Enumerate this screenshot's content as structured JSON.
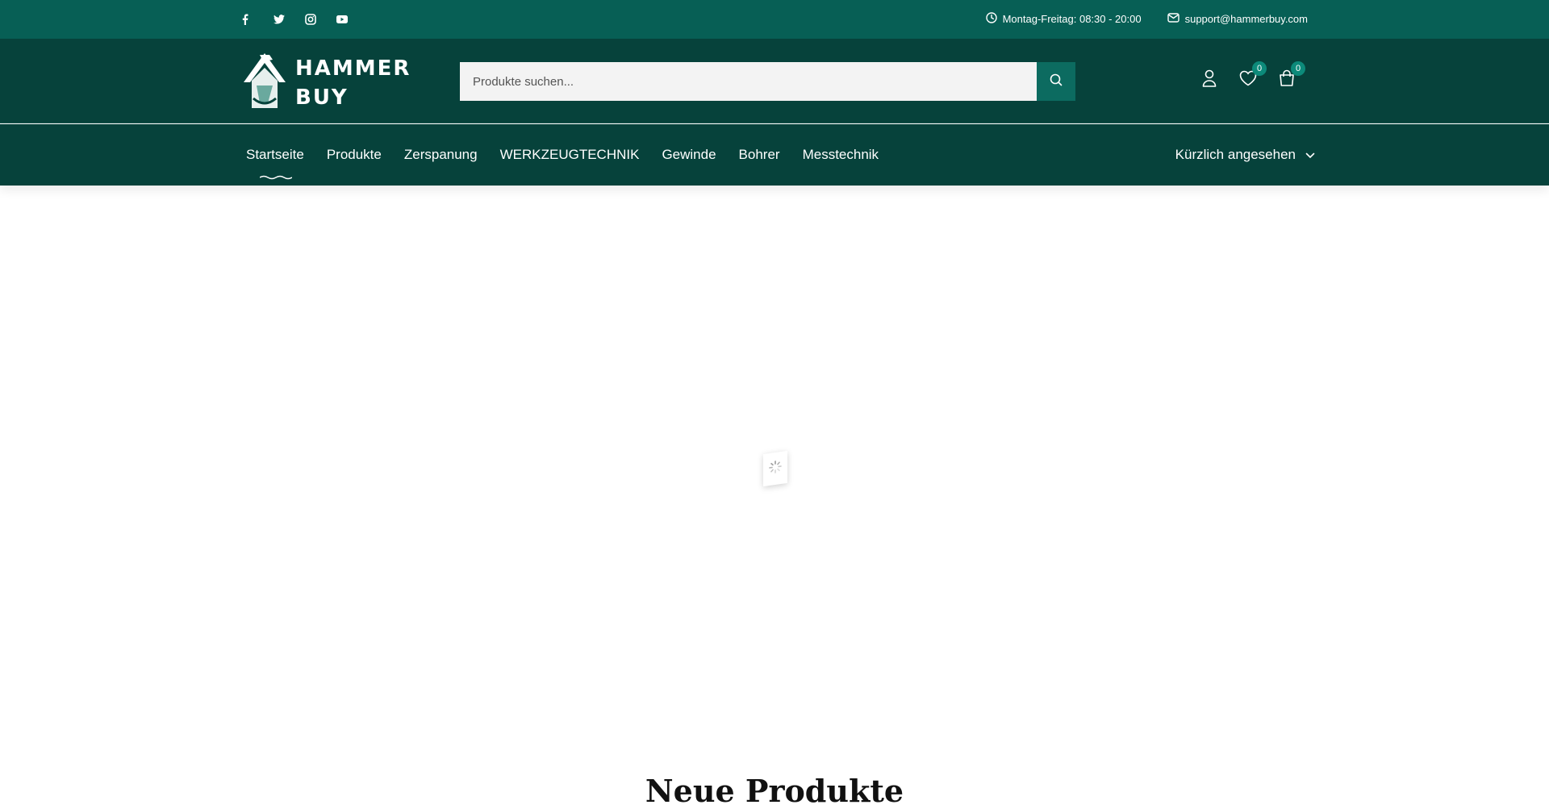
{
  "topbar": {
    "social": [
      "facebook-icon",
      "twitter-icon",
      "instagram-icon",
      "youtube-icon"
    ],
    "hours": "Montag-Freitag: 08:30 - 20:00",
    "email": "support@hammerbuy.com"
  },
  "header": {
    "logo_line1": "HAMMER",
    "logo_line2": "BUY",
    "search_placeholder": "Produkte suchen...",
    "wishlist_count": "0",
    "cart_count": "0"
  },
  "nav": {
    "items": [
      "Startseite",
      "Produkte",
      "Zerspanung",
      "WERKZEUGTECHNIK",
      "Gewinde",
      "Bohrer",
      "Messtechnik"
    ],
    "recent": "Kürzlich angesehen"
  },
  "section": {
    "title": "Neue Produkte"
  },
  "colors": {
    "topbar": "#075f55",
    "header": "#06423b",
    "accent": "#0c6b60"
  }
}
